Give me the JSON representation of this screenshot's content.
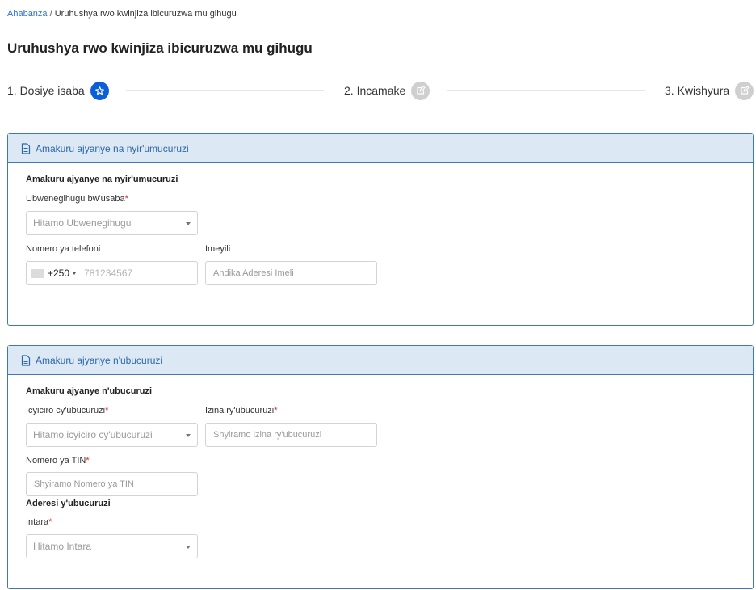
{
  "breadcrumb": {
    "home": "Ahabanza",
    "separator": "/",
    "current": "Uruhushya rwo kwinjiza ibicuruzwa mu gihugu"
  },
  "page": {
    "title": "Uruhushya rwo kwinjiza ibicuruzwa mu gihugu"
  },
  "stepper": {
    "steps": [
      {
        "label": "1. Dosiye isaba",
        "icon": "star-icon",
        "state": "active"
      },
      {
        "label": "2. Incamake",
        "icon": "edit-icon",
        "state": "inactive"
      },
      {
        "label": "3. Kwishyura",
        "icon": "edit-icon",
        "state": "inactive"
      }
    ]
  },
  "owner_panel": {
    "header": "Amakuru ajyanye na nyir'umucuruzi",
    "section_title": "Amakuru ajyanye na nyir'umucuruzi",
    "nationality": {
      "label": "Ubwenegihugu bw'usaba",
      "required": "*",
      "placeholder": "Hitamo Ubwenegihugu"
    },
    "phone": {
      "label": "Nomero ya telefoni",
      "dial_code": "+250",
      "placeholder": "781234567"
    },
    "email": {
      "label": "Imeyili",
      "placeholder": "Andika Aderesi Imeli"
    }
  },
  "business_panel": {
    "header": "Amakuru ajyanye n'ubucuruzi",
    "section_title": "Amakuru ajyanye n'ubucuruzi",
    "category": {
      "label": "Icyiciro cy'ubucuruzi",
      "required": "*",
      "placeholder": "Hitamo icyiciro cy'ubucuruzi"
    },
    "business_name": {
      "label": "Izina ry'ubucuruzi",
      "required": "*",
      "placeholder": "Shyiramo izina ry'ubucuruzi"
    },
    "tin": {
      "label": "Nomero ya TIN",
      "required": "*",
      "placeholder": "Shyiramo Nomero ya TIN"
    },
    "address_title": "Aderesi y'ubucuruzi",
    "province": {
      "label": "Intara",
      "required": "*",
      "placeholder": "Hitamo Intara"
    }
  },
  "colors": {
    "accent": "#0a5ed7",
    "panel_border": "#3f78b7",
    "panel_header_bg": "#dde8f5",
    "required": "#e02424",
    "inactive_step": "#cfcfcf"
  }
}
